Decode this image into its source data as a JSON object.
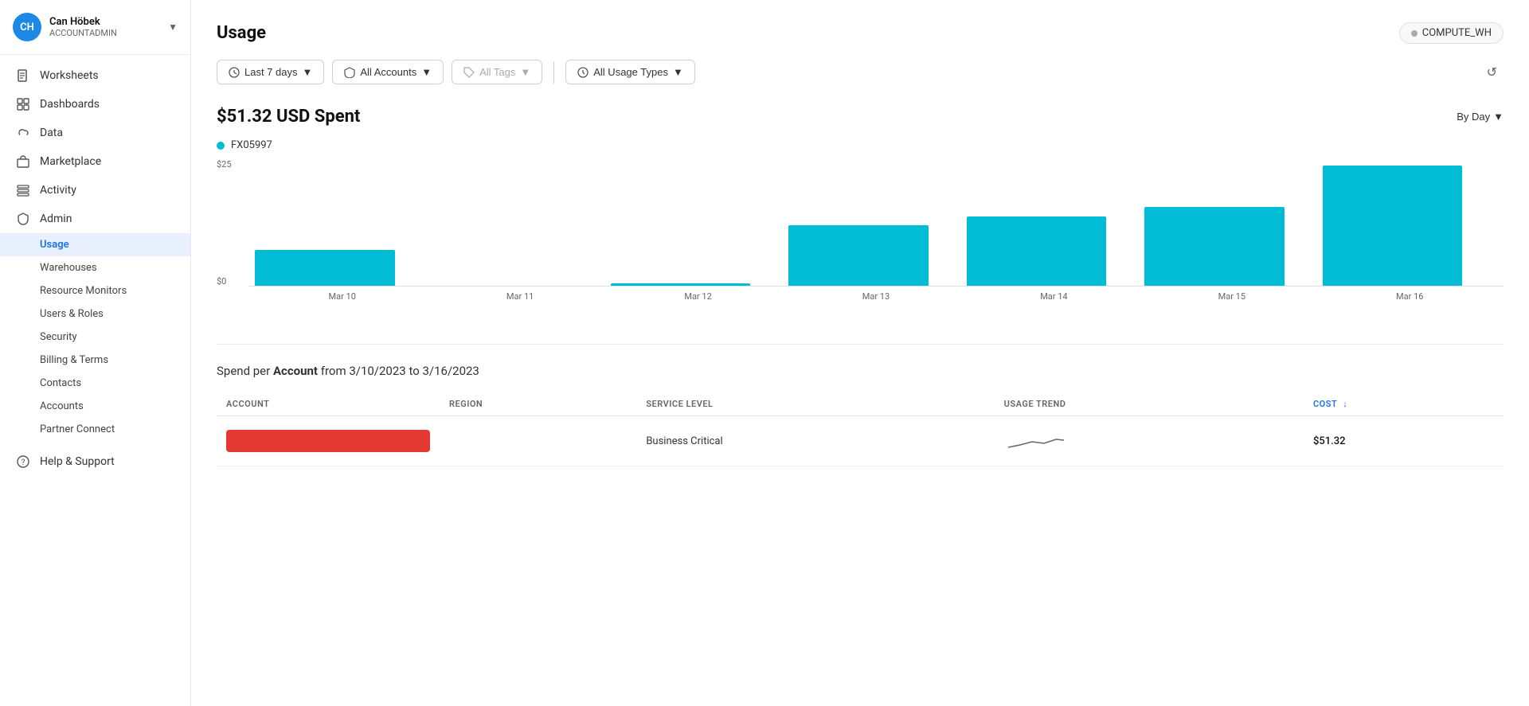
{
  "sidebar": {
    "user": {
      "initials": "CH",
      "name": "Can Höbek",
      "role": "ACCOUNTADMIN"
    },
    "nav_items": [
      {
        "id": "worksheets",
        "label": "Worksheets",
        "icon": "file-icon"
      },
      {
        "id": "dashboards",
        "label": "Dashboards",
        "icon": "grid-icon"
      },
      {
        "id": "data",
        "label": "Data",
        "icon": "cloud-icon"
      },
      {
        "id": "marketplace",
        "label": "Marketplace",
        "icon": "shop-icon"
      },
      {
        "id": "activity",
        "label": "Activity",
        "icon": "list-icon"
      },
      {
        "id": "admin",
        "label": "Admin",
        "icon": "shield-icon"
      }
    ],
    "admin_sub_items": [
      {
        "id": "usage",
        "label": "Usage",
        "active": true
      },
      {
        "id": "warehouses",
        "label": "Warehouses",
        "active": false
      },
      {
        "id": "resource-monitors",
        "label": "Resource Monitors",
        "active": false
      },
      {
        "id": "users-roles",
        "label": "Users & Roles",
        "active": false
      },
      {
        "id": "security",
        "label": "Security",
        "active": false
      },
      {
        "id": "billing-terms",
        "label": "Billing & Terms",
        "active": false
      },
      {
        "id": "contacts",
        "label": "Contacts",
        "active": false
      },
      {
        "id": "accounts",
        "label": "Accounts",
        "active": false
      },
      {
        "id": "partner-connect",
        "label": "Partner Connect",
        "active": false
      }
    ],
    "footer_item": {
      "label": "Help & Support",
      "icon": "help-icon"
    }
  },
  "header": {
    "title": "Usage",
    "warehouse": "COMPUTE_WH"
  },
  "filters": {
    "time_range": "Last 7 days",
    "accounts": "All Accounts",
    "tags": "All Tags",
    "usage_types": "All Usage Types"
  },
  "chart": {
    "amount": "$51.32 USD Spent",
    "view_mode": "By Day",
    "legend_label": "FX05997",
    "y_labels": [
      "$25",
      "$0"
    ],
    "bars": [
      {
        "date": "Mar 10",
        "height_pct": 28
      },
      {
        "date": "Mar 11",
        "height_pct": 0
      },
      {
        "date": "Mar 12",
        "height_pct": 2
      },
      {
        "date": "Mar 13",
        "height_pct": 48
      },
      {
        "date": "Mar 14",
        "height_pct": 55
      },
      {
        "date": "Mar 15",
        "height_pct": 60
      },
      {
        "date": "Mar 16",
        "height_pct": 95
      }
    ]
  },
  "table": {
    "title_prefix": "Spend per",
    "title_bold": "Account",
    "title_suffix": "from 3/10/2023 to 3/16/2023",
    "columns": [
      {
        "id": "account",
        "label": "ACCOUNT"
      },
      {
        "id": "region",
        "label": "REGION"
      },
      {
        "id": "service_level",
        "label": "SERVICE LEVEL"
      },
      {
        "id": "usage_trend",
        "label": "USAGE TREND"
      },
      {
        "id": "cost",
        "label": "COST",
        "sort_arrow": "↓"
      }
    ],
    "rows": [
      {
        "account_bar": true,
        "region": "",
        "service_level": "Business Critical",
        "cost": "$51.32"
      }
    ]
  }
}
